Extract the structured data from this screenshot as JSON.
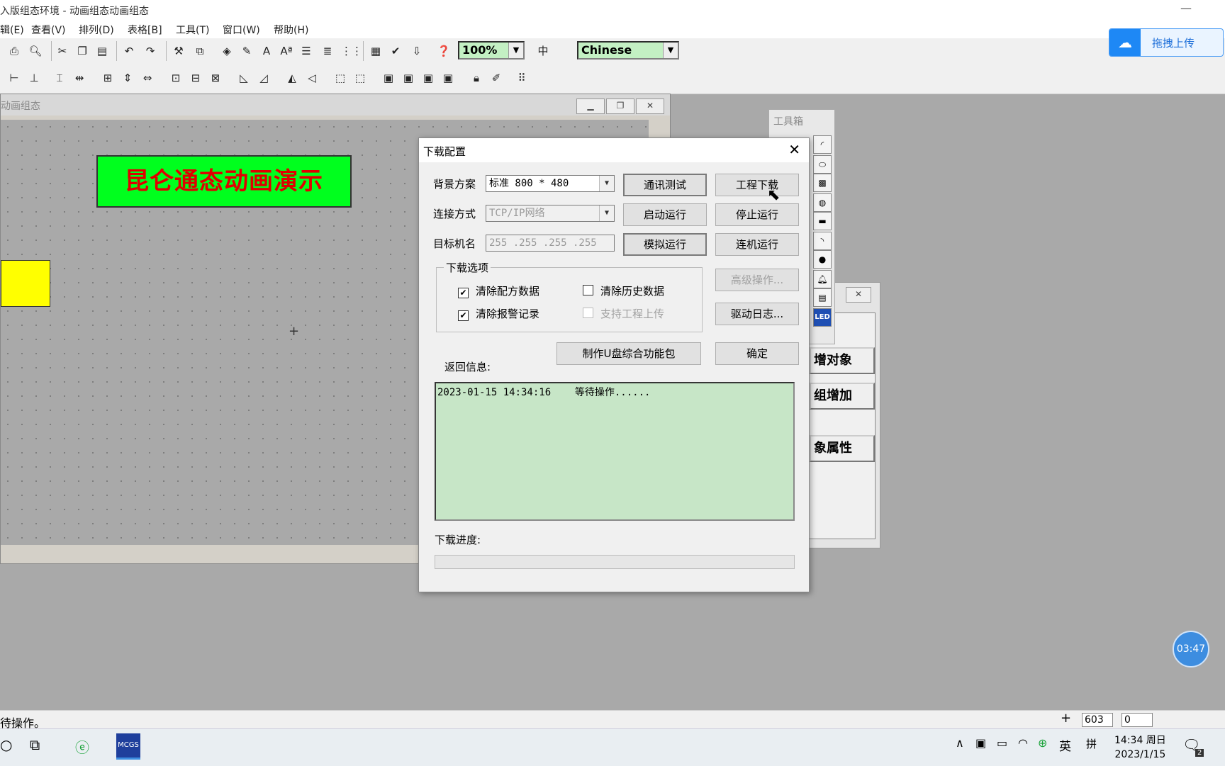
{
  "window": {
    "title": "入版组态环境 - 动画组态动画组态",
    "min_glyph": "—"
  },
  "menu": [
    "辑(E)",
    "查看(V)",
    "排列(D)",
    "表格[B]",
    "工具(T)",
    "窗口(W)",
    "帮助(H)"
  ],
  "toolbar": {
    "zoom": "100%",
    "language": "Chinese"
  },
  "upload": {
    "label": "拖拽上传"
  },
  "child_window": {
    "title": "动画组态",
    "headline": "昆仑通态动画演示"
  },
  "toolbox": {
    "title": "工具箱",
    "led": "LED"
  },
  "right_panel": {
    "buttons": [
      "增对象",
      "组增加",
      "象属性"
    ]
  },
  "dialog": {
    "title": "下载配置",
    "close": "✕",
    "bg_label": "背景方案",
    "bg_value": "标准 800 * 480",
    "conn_label": "连接方式",
    "conn_value": "TCP/IP网络",
    "target_label": "目标机名",
    "target_value": "255 .255 .255 .255",
    "buttons": {
      "comm_test": "通讯测试",
      "project_download": "工程下载",
      "start_run": "启动运行",
      "stop_run": "停止运行",
      "simulate_run": "模拟运行",
      "online_run": "连机运行",
      "advanced": "高级操作...",
      "driver_log": "驱动日志...",
      "make_usb": "制作U盘综合功能包",
      "ok": "确定"
    },
    "options_title": "下载选项",
    "options": {
      "clear_recipe": "清除配方数据",
      "clear_history": "清除历史数据",
      "clear_alarm": "清除报警记录",
      "support_upload": "支持工程上传"
    },
    "return_label": "返回信息:",
    "log_time": "2023-01-15 14:34:16",
    "log_msg": "等待操作......",
    "progress_label": "下载进度:",
    "progress": 0
  },
  "timer": "03:47",
  "status": {
    "message": "待操作。",
    "x": "603",
    "y": "0"
  },
  "taskbar": {
    "ime_lang": "英",
    "ime_mode": "拼",
    "time": "14:34 周日",
    "date": "2023/1/15",
    "notif_count": "2"
  },
  "colors": {
    "headline_bg": "#00ff1e",
    "headline_text": "#e00000",
    "log_bg": "#c7e6c7",
    "accent": "#1e88f5"
  }
}
